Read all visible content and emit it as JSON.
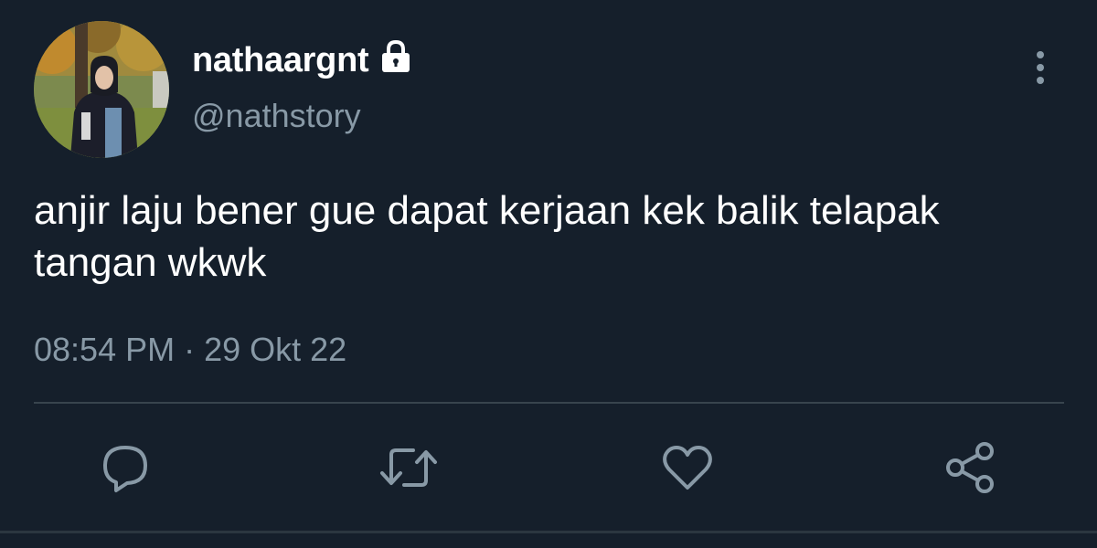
{
  "tweet": {
    "display_name": "nathaargnt",
    "handle": "@nathstory",
    "text": "anjir laju bener gue dapat kerjaan kek balik telapak tangan wkwk",
    "timestamp": "08:54 PM · 29 Okt 22",
    "protected": true
  },
  "icons": {
    "lock": "lock-icon",
    "more": "more-vertical-icon",
    "reply": "reply-icon",
    "retweet": "retweet-icon",
    "like": "heart-icon",
    "share": "share-icon"
  },
  "colors": {
    "background": "#151f2b",
    "primary_text": "#ffffff",
    "secondary_text": "#8899a6",
    "divider": "#38444d"
  }
}
